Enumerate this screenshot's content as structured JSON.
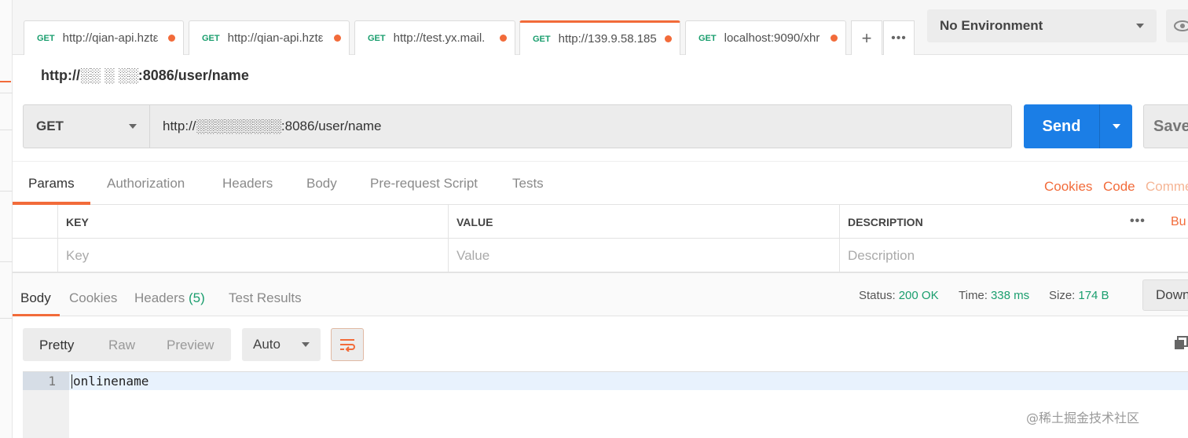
{
  "tabs": [
    {
      "method": "GET",
      "url": "http://qian-api.hztε"
    },
    {
      "method": "GET",
      "url": "http://qian-api.hztε"
    },
    {
      "method": "GET",
      "url": "http://test.yx.mail."
    },
    {
      "method": "GET",
      "url": "http://139.9.58.185"
    },
    {
      "method": "GET",
      "url": "localhost:9090/xhr"
    }
  ],
  "environment": {
    "selected": "No Environment"
  },
  "request": {
    "title": "http://░░ ░ ░░:8086/user/name",
    "method": "GET",
    "url": "http://░░░░░░░░░:8086/user/name",
    "send_label": "Send",
    "save_label": "Save"
  },
  "request_tabs": {
    "params": "Params",
    "authorization": "Authorization",
    "headers": "Headers",
    "body": "Body",
    "pre_request": "Pre-request Script",
    "tests": "Tests",
    "cookies": "Cookies",
    "code": "Code",
    "comments": "Comme"
  },
  "params_table": {
    "columns": [
      "KEY",
      "VALUE",
      "DESCRIPTION"
    ],
    "placeholders": [
      "Key",
      "Value",
      "Description"
    ],
    "bulk_edit": "Bu"
  },
  "response": {
    "tabs": {
      "body": "Body",
      "cookies": "Cookies",
      "headers": "Headers",
      "headers_count": "(5)",
      "test_results": "Test Results"
    },
    "status_label": "Status:",
    "status_value": "200 OK",
    "time_label": "Time:",
    "time_value": "338 ms",
    "size_label": "Size:",
    "size_value": "174 B",
    "download_label": "Down"
  },
  "body_toolbar": {
    "pretty": "Pretty",
    "raw": "Raw",
    "preview": "Preview",
    "format": "Auto"
  },
  "editor": {
    "line_number": "1",
    "content": "onlinename"
  },
  "watermark": "@稀土掘金技术社区",
  "colors": {
    "accent": "#f26b3a",
    "send": "#1b7ee6",
    "success": "#1a9e6e"
  }
}
